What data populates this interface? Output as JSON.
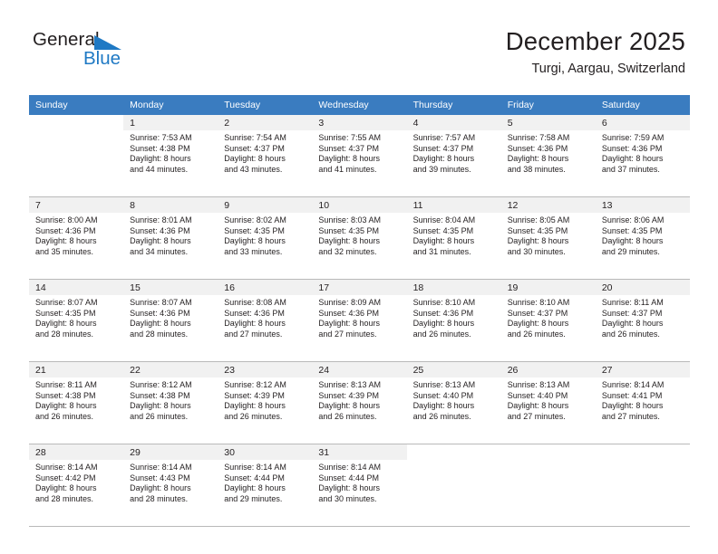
{
  "brand": {
    "name_part1": "General",
    "name_part2": "Blue",
    "flag_icon": "triangle-flag-icon",
    "blue_hex": "#1f79c4"
  },
  "header": {
    "title": "December 2025",
    "subtitle": "Turgi, Aargau, Switzerland"
  },
  "theme": {
    "header_row_bg": "#3a7cc0",
    "daynum_bg": "#f1f1f1",
    "separator": "#b9b9b9",
    "text": "#231f20"
  },
  "weekday_headers": [
    "Sunday",
    "Monday",
    "Tuesday",
    "Wednesday",
    "Thursday",
    "Friday",
    "Saturday"
  ],
  "weeks": [
    [
      {
        "day": "",
        "sunrise": "",
        "sunset": "",
        "daylight_line1": "",
        "daylight_line2": ""
      },
      {
        "day": "1",
        "sunrise": "Sunrise: 7:53 AM",
        "sunset": "Sunset: 4:38 PM",
        "daylight_line1": "Daylight: 8 hours",
        "daylight_line2": "and 44 minutes."
      },
      {
        "day": "2",
        "sunrise": "Sunrise: 7:54 AM",
        "sunset": "Sunset: 4:37 PM",
        "daylight_line1": "Daylight: 8 hours",
        "daylight_line2": "and 43 minutes."
      },
      {
        "day": "3",
        "sunrise": "Sunrise: 7:55 AM",
        "sunset": "Sunset: 4:37 PM",
        "daylight_line1": "Daylight: 8 hours",
        "daylight_line2": "and 41 minutes."
      },
      {
        "day": "4",
        "sunrise": "Sunrise: 7:57 AM",
        "sunset": "Sunset: 4:37 PM",
        "daylight_line1": "Daylight: 8 hours",
        "daylight_line2": "and 39 minutes."
      },
      {
        "day": "5",
        "sunrise": "Sunrise: 7:58 AM",
        "sunset": "Sunset: 4:36 PM",
        "daylight_line1": "Daylight: 8 hours",
        "daylight_line2": "and 38 minutes."
      },
      {
        "day": "6",
        "sunrise": "Sunrise: 7:59 AM",
        "sunset": "Sunset: 4:36 PM",
        "daylight_line1": "Daylight: 8 hours",
        "daylight_line2": "and 37 minutes."
      }
    ],
    [
      {
        "day": "7",
        "sunrise": "Sunrise: 8:00 AM",
        "sunset": "Sunset: 4:36 PM",
        "daylight_line1": "Daylight: 8 hours",
        "daylight_line2": "and 35 minutes."
      },
      {
        "day": "8",
        "sunrise": "Sunrise: 8:01 AM",
        "sunset": "Sunset: 4:36 PM",
        "daylight_line1": "Daylight: 8 hours",
        "daylight_line2": "and 34 minutes."
      },
      {
        "day": "9",
        "sunrise": "Sunrise: 8:02 AM",
        "sunset": "Sunset: 4:35 PM",
        "daylight_line1": "Daylight: 8 hours",
        "daylight_line2": "and 33 minutes."
      },
      {
        "day": "10",
        "sunrise": "Sunrise: 8:03 AM",
        "sunset": "Sunset: 4:35 PM",
        "daylight_line1": "Daylight: 8 hours",
        "daylight_line2": "and 32 minutes."
      },
      {
        "day": "11",
        "sunrise": "Sunrise: 8:04 AM",
        "sunset": "Sunset: 4:35 PM",
        "daylight_line1": "Daylight: 8 hours",
        "daylight_line2": "and 31 minutes."
      },
      {
        "day": "12",
        "sunrise": "Sunrise: 8:05 AM",
        "sunset": "Sunset: 4:35 PM",
        "daylight_line1": "Daylight: 8 hours",
        "daylight_line2": "and 30 minutes."
      },
      {
        "day": "13",
        "sunrise": "Sunrise: 8:06 AM",
        "sunset": "Sunset: 4:35 PM",
        "daylight_line1": "Daylight: 8 hours",
        "daylight_line2": "and 29 minutes."
      }
    ],
    [
      {
        "day": "14",
        "sunrise": "Sunrise: 8:07 AM",
        "sunset": "Sunset: 4:35 PM",
        "daylight_line1": "Daylight: 8 hours",
        "daylight_line2": "and 28 minutes."
      },
      {
        "day": "15",
        "sunrise": "Sunrise: 8:07 AM",
        "sunset": "Sunset: 4:36 PM",
        "daylight_line1": "Daylight: 8 hours",
        "daylight_line2": "and 28 minutes."
      },
      {
        "day": "16",
        "sunrise": "Sunrise: 8:08 AM",
        "sunset": "Sunset: 4:36 PM",
        "daylight_line1": "Daylight: 8 hours",
        "daylight_line2": "and 27 minutes."
      },
      {
        "day": "17",
        "sunrise": "Sunrise: 8:09 AM",
        "sunset": "Sunset: 4:36 PM",
        "daylight_line1": "Daylight: 8 hours",
        "daylight_line2": "and 27 minutes."
      },
      {
        "day": "18",
        "sunrise": "Sunrise: 8:10 AM",
        "sunset": "Sunset: 4:36 PM",
        "daylight_line1": "Daylight: 8 hours",
        "daylight_line2": "and 26 minutes."
      },
      {
        "day": "19",
        "sunrise": "Sunrise: 8:10 AM",
        "sunset": "Sunset: 4:37 PM",
        "daylight_line1": "Daylight: 8 hours",
        "daylight_line2": "and 26 minutes."
      },
      {
        "day": "20",
        "sunrise": "Sunrise: 8:11 AM",
        "sunset": "Sunset: 4:37 PM",
        "daylight_line1": "Daylight: 8 hours",
        "daylight_line2": "and 26 minutes."
      }
    ],
    [
      {
        "day": "21",
        "sunrise": "Sunrise: 8:11 AM",
        "sunset": "Sunset: 4:38 PM",
        "daylight_line1": "Daylight: 8 hours",
        "daylight_line2": "and 26 minutes."
      },
      {
        "day": "22",
        "sunrise": "Sunrise: 8:12 AM",
        "sunset": "Sunset: 4:38 PM",
        "daylight_line1": "Daylight: 8 hours",
        "daylight_line2": "and 26 minutes."
      },
      {
        "day": "23",
        "sunrise": "Sunrise: 8:12 AM",
        "sunset": "Sunset: 4:39 PM",
        "daylight_line1": "Daylight: 8 hours",
        "daylight_line2": "and 26 minutes."
      },
      {
        "day": "24",
        "sunrise": "Sunrise: 8:13 AM",
        "sunset": "Sunset: 4:39 PM",
        "daylight_line1": "Daylight: 8 hours",
        "daylight_line2": "and 26 minutes."
      },
      {
        "day": "25",
        "sunrise": "Sunrise: 8:13 AM",
        "sunset": "Sunset: 4:40 PM",
        "daylight_line1": "Daylight: 8 hours",
        "daylight_line2": "and 26 minutes."
      },
      {
        "day": "26",
        "sunrise": "Sunrise: 8:13 AM",
        "sunset": "Sunset: 4:40 PM",
        "daylight_line1": "Daylight: 8 hours",
        "daylight_line2": "and 27 minutes."
      },
      {
        "day": "27",
        "sunrise": "Sunrise: 8:14 AM",
        "sunset": "Sunset: 4:41 PM",
        "daylight_line1": "Daylight: 8 hours",
        "daylight_line2": "and 27 minutes."
      }
    ],
    [
      {
        "day": "28",
        "sunrise": "Sunrise: 8:14 AM",
        "sunset": "Sunset: 4:42 PM",
        "daylight_line1": "Daylight: 8 hours",
        "daylight_line2": "and 28 minutes."
      },
      {
        "day": "29",
        "sunrise": "Sunrise: 8:14 AM",
        "sunset": "Sunset: 4:43 PM",
        "daylight_line1": "Daylight: 8 hours",
        "daylight_line2": "and 28 minutes."
      },
      {
        "day": "30",
        "sunrise": "Sunrise: 8:14 AM",
        "sunset": "Sunset: 4:44 PM",
        "daylight_line1": "Daylight: 8 hours",
        "daylight_line2": "and 29 minutes."
      },
      {
        "day": "31",
        "sunrise": "Sunrise: 8:14 AM",
        "sunset": "Sunset: 4:44 PM",
        "daylight_line1": "Daylight: 8 hours",
        "daylight_line2": "and 30 minutes."
      },
      {
        "day": "",
        "sunrise": "",
        "sunset": "",
        "daylight_line1": "",
        "daylight_line2": ""
      },
      {
        "day": "",
        "sunrise": "",
        "sunset": "",
        "daylight_line1": "",
        "daylight_line2": ""
      },
      {
        "day": "",
        "sunrise": "",
        "sunset": "",
        "daylight_line1": "",
        "daylight_line2": ""
      }
    ]
  ]
}
